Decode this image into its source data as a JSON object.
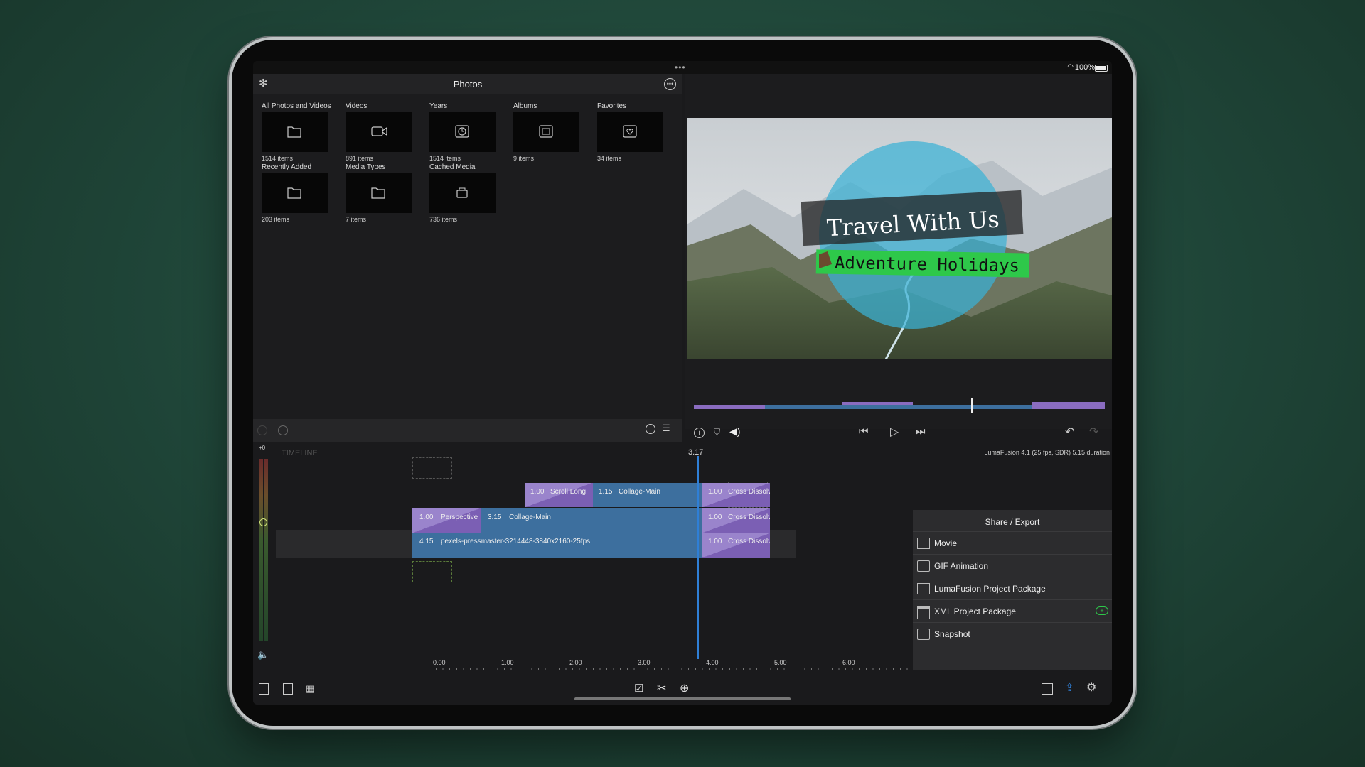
{
  "status": {
    "battery": "100%"
  },
  "photos": {
    "title": "Photos",
    "tiles": [
      {
        "label": "All Photos and Videos",
        "count": "1514 items",
        "icon": "folder-icon"
      },
      {
        "label": "Videos",
        "count": "891 items",
        "icon": "video-camera-icon"
      },
      {
        "label": "Years",
        "count": "1514 items",
        "icon": "clock-icon"
      },
      {
        "label": "Albums",
        "count": "9 items",
        "icon": "albums-icon"
      },
      {
        "label": "Favorites",
        "count": "34 items",
        "icon": "heart-icon"
      },
      {
        "label": "Recently Added",
        "count": "203 items",
        "icon": "folder-icon"
      },
      {
        "label": "Media Types",
        "count": "7 items",
        "icon": "folder-icon"
      },
      {
        "label": "Cached Media",
        "count": "736 items",
        "icon": "storage-icon"
      }
    ]
  },
  "preview": {
    "title_line": "Travel With Us",
    "subtitle_line": "Adventure Holidays"
  },
  "timeline": {
    "label": "TIMELINE",
    "current_time": "3.17",
    "info": "LumaFusion 4.1 (25 fps, SDR)  5.15 duration",
    "meter_top": "+0",
    "clips": {
      "top_a_dur": "1.00",
      "top_a_name": "Scroll Long",
      "top_b_dur": "1.15",
      "top_b_name": "Collage-Main",
      "top_c_dur": "1.00",
      "top_c_name": "Cross Dissolve",
      "mid_a_dur": "1.00",
      "mid_a_name": "Perspective",
      "mid_b_dur": "3.15",
      "mid_b_name": "Collage-Main",
      "mid_c_dur": "1.00",
      "mid_c_name": "Cross Dissolve",
      "main_dur": "4.15",
      "main_name": "pexels-pressmaster-3214448-3840x2160-25fps",
      "main_c_dur": "1.00",
      "main_c_name": "Cross Dissolve"
    },
    "ruler": [
      "0.00",
      "1.00",
      "2.00",
      "3.00",
      "4.00",
      "5.00",
      "6.00"
    ]
  },
  "share": {
    "title": "Share / Export",
    "items": [
      {
        "label": "Movie",
        "icon": "film-icon"
      },
      {
        "label": "GIF Animation",
        "icon": "gif-icon"
      },
      {
        "label": "LumaFusion Project Package",
        "icon": "package-icon"
      },
      {
        "label": "XML Project Package",
        "icon": "clapper-icon"
      },
      {
        "label": "Snapshot",
        "icon": "camera-icon"
      }
    ]
  },
  "colors": {
    "accent": "#2f7fd6",
    "clip_blue": "#3d6f9e",
    "clip_purple": "#8a6cc0",
    "banner_green": "#2ec84a"
  }
}
